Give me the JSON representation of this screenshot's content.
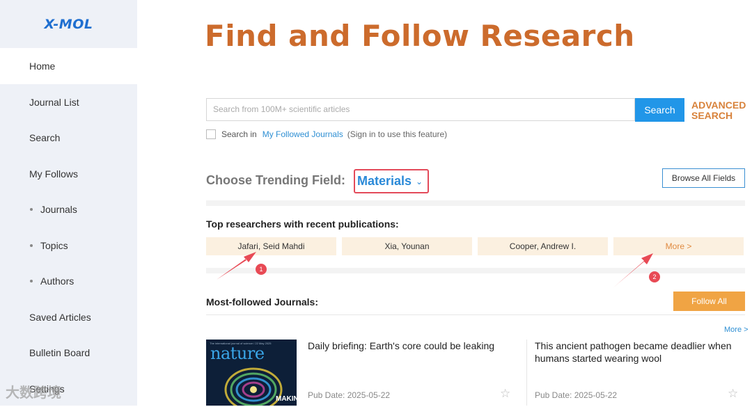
{
  "logo": "X-MOL",
  "sidebar": {
    "items": [
      {
        "label": "Home"
      },
      {
        "label": "Journal List"
      },
      {
        "label": "Search"
      },
      {
        "label": "My Follows"
      },
      {
        "label": "Journals"
      },
      {
        "label": "Topics"
      },
      {
        "label": "Authors"
      },
      {
        "label": "Saved Articles"
      },
      {
        "label": "Bulletin Board"
      },
      {
        "label": "Settings"
      }
    ]
  },
  "header": {
    "title": "Find and Follow Research"
  },
  "search": {
    "placeholder": "Search from 100M+ scientific articles",
    "button": "Search",
    "advanced": "ADVANCED SEARCH",
    "scope_prefix": "Search in",
    "scope_link": "My Followed Journals",
    "scope_hint": "(Sign in to use this feature)"
  },
  "trending": {
    "label": "Choose Trending Field:",
    "selected": "Materials",
    "browse_all": "Browse All Fields"
  },
  "researchers": {
    "title": "Top researchers with recent publications:",
    "names": [
      "Jafari, Seid Mahdi",
      "Xia, Younan",
      "Cooper, Andrew I."
    ],
    "more": "More >"
  },
  "journals": {
    "title": "Most-followed Journals:",
    "follow_all": "Follow All",
    "more": "More >",
    "cover": {
      "brand": "nature",
      "topline": "The international journal of science / 22 May 2025",
      "caption": "MAKING"
    },
    "articles": [
      {
        "title": "Daily briefing: Earth's core could be leaking",
        "pub_date": "Pub Date: 2025-05-22"
      },
      {
        "title": "This ancient pathogen became deadlier when humans started wearing wool",
        "pub_date": "Pub Date: 2025-05-22"
      }
    ]
  },
  "annotations": [
    "1",
    "2"
  ],
  "watermark": "大数跨境",
  "colors": {
    "accent": "#2196e8",
    "title": "#cc6b2c",
    "highlight": "#e34a5a",
    "chip": "#fbf0e0",
    "follow": "#f0a444"
  }
}
